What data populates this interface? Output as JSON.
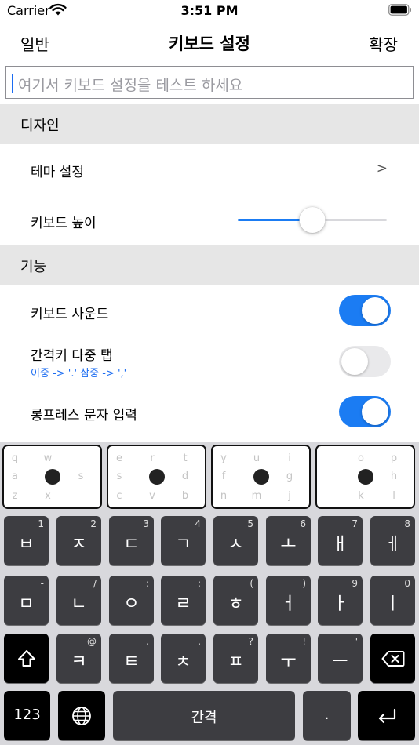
{
  "status_bar": {
    "carrier": "Carrier",
    "time": "3:51 PM"
  },
  "nav": {
    "left": "일반",
    "title": "키보드 설정",
    "right": "확장"
  },
  "test_input": {
    "placeholder": "여기서 키보드 설정을 테스트 하세요"
  },
  "sections": [
    {
      "header": "디자인"
    },
    {
      "header": "기능"
    }
  ],
  "design": {
    "theme_label": "테마 설정",
    "theme_chevron": ">",
    "height_label": "키보드 높이",
    "height_value_fraction": 0.5
  },
  "features": {
    "sound_label": "키보드 사운드",
    "sound_on": true,
    "space_tap_label": "간격키 다중 탭",
    "space_tap_sub": "이중 -> '.' 삼중 -> ','",
    "space_tap_on": false,
    "long_press_label": "롱프레스 문자 입력",
    "long_press_on": true
  },
  "gesture_pads": [
    {
      "letters": [
        "q",
        "w",
        "",
        "a",
        "",
        "s",
        "z",
        "x",
        ""
      ]
    },
    {
      "letters": [
        "e",
        "r",
        "t",
        "s",
        "",
        "d",
        "c",
        "v",
        "b"
      ]
    },
    {
      "letters": [
        "y",
        "u",
        "i",
        "f",
        "",
        "g",
        "n",
        "m",
        "j"
      ]
    },
    {
      "letters": [
        "",
        "o",
        "p",
        "",
        "",
        "h",
        "",
        "k",
        "l"
      ]
    }
  ],
  "keys": {
    "row1": [
      {
        "main": "ㅂ",
        "sub": "1"
      },
      {
        "main": "ㅈ",
        "sub": "2"
      },
      {
        "main": "ㄷ",
        "sub": "3"
      },
      {
        "main": "ㄱ",
        "sub": "4"
      },
      {
        "main": "ㅅ",
        "sub": "5"
      },
      {
        "main": "ㅗ",
        "sub": "6"
      },
      {
        "main": "ㅐ",
        "sub": "7"
      },
      {
        "main": "ㅔ",
        "sub": "8"
      }
    ],
    "row2": [
      {
        "main": "ㅁ",
        "sub": "-"
      },
      {
        "main": "ㄴ",
        "sub": "/"
      },
      {
        "main": "ㅇ",
        "sub": ":"
      },
      {
        "main": "ㄹ",
        "sub": ";"
      },
      {
        "main": "ㅎ",
        "sub": "("
      },
      {
        "main": "ㅓ",
        "sub": ")"
      },
      {
        "main": "ㅏ",
        "sub": "9"
      },
      {
        "main": "ㅣ",
        "sub": "0"
      }
    ],
    "row3": [
      {
        "main": "ㅋ",
        "sub": "@"
      },
      {
        "main": "ㅌ",
        "sub": "."
      },
      {
        "main": "ㅊ",
        "sub": ","
      },
      {
        "main": "ㅍ",
        "sub": "?"
      },
      {
        "main": "ㅜ",
        "sub": "!"
      },
      {
        "main": "ㅡ",
        "sub": "'"
      }
    ],
    "numbers": "123",
    "space": "간격",
    "period": "."
  },
  "colors": {
    "accent": "#1b7cf3",
    "key_bg": "#3d3d41",
    "keyboard_bg": "#d8d8dc",
    "section_bg": "#e6e6e6"
  },
  "icons": [
    "wifi-icon",
    "battery-icon",
    "shift-icon",
    "backspace-icon",
    "globe-icon",
    "return-icon"
  ]
}
